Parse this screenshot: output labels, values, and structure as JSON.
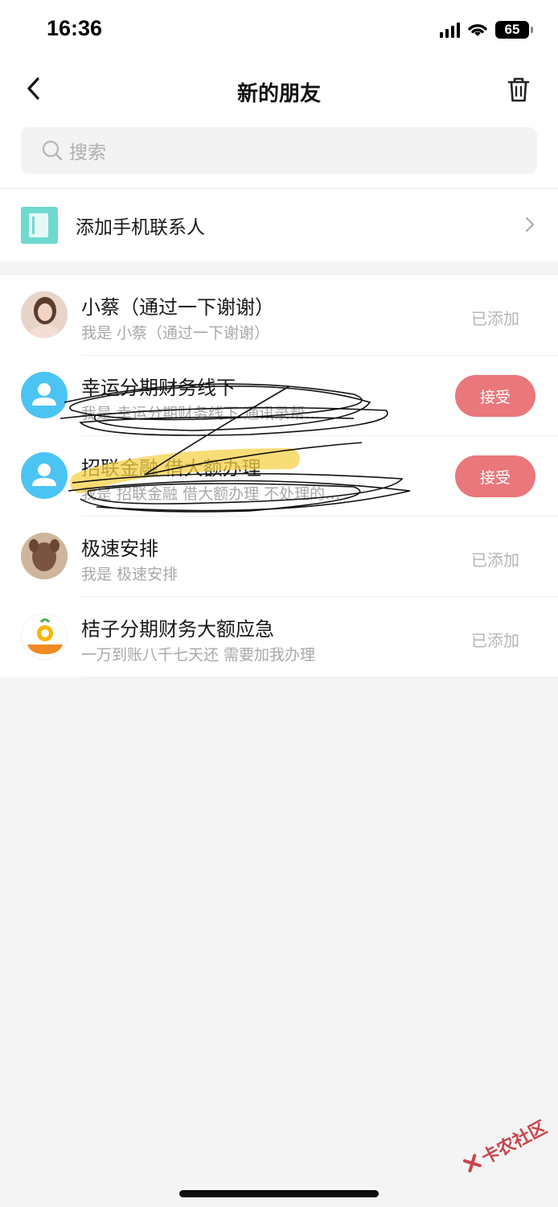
{
  "status_bar": {
    "time": "16:36",
    "battery": "65"
  },
  "nav": {
    "title": "新的朋友",
    "back_icon": "chevron-left-icon",
    "trash_icon": "trash-icon"
  },
  "search": {
    "placeholder": "搜索",
    "icon": "search-icon"
  },
  "add_contact": {
    "label": "添加手机联系人",
    "icon": "phone-book-icon"
  },
  "friends": [
    {
      "name": "小蔡（通过一下谢谢）",
      "message": "我是 小蔡（通过一下谢谢）",
      "status": "已添加"
    },
    {
      "name": "幸运分期财务线下",
      "message": "我是 幸运分期财务线下 通讯录帮…",
      "action": "接受"
    },
    {
      "name": "招联金融 借大额办理",
      "message": "我是 招联金融 借大额办理 不处理的…",
      "action": "接受"
    },
    {
      "name": "极速安排",
      "message": "我是 极速安排",
      "status": "已添加"
    },
    {
      "name": "桔子分期财务大额应急",
      "message": "一万到账八千七天还 需要加我办理",
      "status": "已添加"
    }
  ],
  "watermark": {
    "text": "卡农社区"
  },
  "colors": {
    "accept": "#e9777b",
    "avatar_default": "#4bc4f4",
    "background": "#f4f4f4"
  }
}
